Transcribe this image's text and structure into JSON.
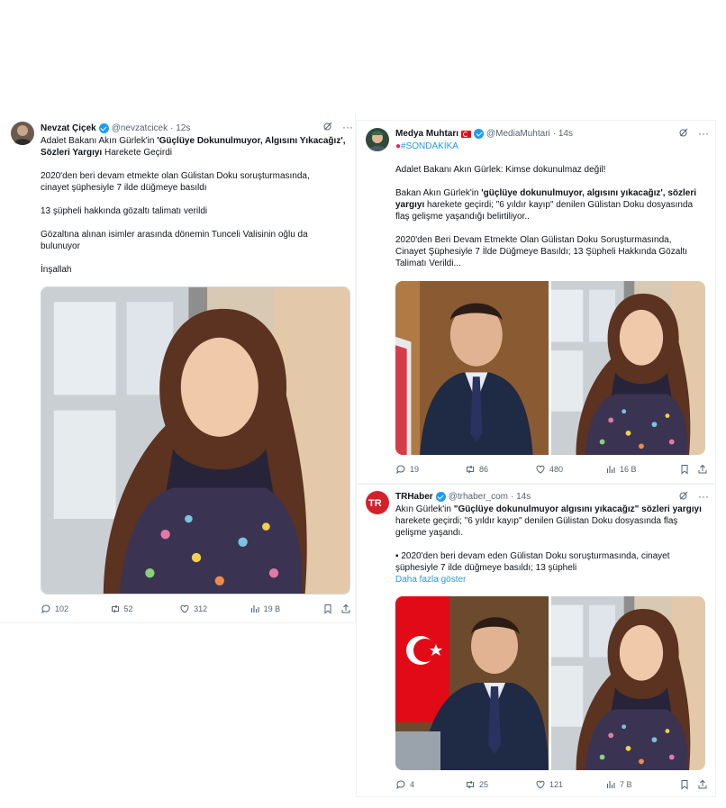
{
  "tweets": [
    {
      "name": "Nevzat Çiçek",
      "handle": "@nevzatcicek",
      "time": "· 12s",
      "lines": {
        "l1a": "Adalet Bakanı Akın Gürlek'in ",
        "l1b": "'Güçlüye Dokunulmuyor, Algısını Yıkacağız',",
        "l2a": "Sözleri Yargıyı",
        "l2b": " Harekete Geçirdi",
        "p2a": "2020'den beri devam etmekte olan Gülistan Doku soruşturmasında,",
        "p2b": "cinayet şüphesiyle 7 ilde düğmeye basıldı",
        "p3": "13 şüpheli hakkında gözaltı talimatı verildi",
        "p4a": "Gözaltına alınan isimler arasında dönemin Tunceli Valisinin oğlu da",
        "p4b": "bulunuyor",
        "p5": "İnşallah"
      },
      "stats": {
        "replies": "102",
        "reposts": "52",
        "likes": "312",
        "views": "19 B"
      }
    },
    {
      "name": "Medya Muhtarı",
      "handle": "@MediaMuhtari",
      "time": "· 14s",
      "lines": {
        "tag": "#SONDAKİKA",
        "p1": "Adalet Bakanı Akın Gürlek: Kimse dokunulmaz değil!",
        "p2a": "Bakan Akın Gürlek'in ",
        "p2b": "'güçlüye dokunulmuyor, algısını yıkacağız'",
        "p2c": ", sözleri",
        "p2d": "yargıyı",
        "p2e": " harekete geçirdi; \"6 yıldır kayıp\" denilen Gülistan Doku dosyasında",
        "p2f": "flaş gelişme yaşandığı belirtiliyor..",
        "p3a": "2020'den Beri Devam Etmekte Olan Gülistan Doku Soruşturmasında,",
        "p3b": "Cinayet Şüphesiyle 7 İlde Düğmeye Basıldı; 13 Şüpheli Hakkında Gözaltı",
        "p3c": "Talimatı Verildi..."
      },
      "stats": {
        "replies": "19",
        "reposts": "86",
        "likes": "480",
        "views": "16 B"
      }
    },
    {
      "name": "TRHaber",
      "handle": "@trhaber_com",
      "time": "· 14s",
      "lines": {
        "p1a": "Akın Gürlek'in ",
        "p1b": "\"Güçlüye dokunulmuyor algısını yıkacağız\" sözleri yargıyı",
        "p1c": "harekete geçirdi; \"6 yıldır kayıp\" denilen Gülistan Doku dosyasında flaş",
        "p1d": "gelişme yaşandı.",
        "p2a": "▪ 2020'den beri devam eden Gülistan Doku soruşturmasında, cinayet",
        "p2b": "şüphesiyle 7 ilde düğmeye basıldı; 13 şüpheli",
        "more": "Daha fazla göster"
      },
      "stats": {
        "replies": "4",
        "reposts": "25",
        "likes": "121",
        "views": "7 B"
      }
    }
  ],
  "icons": [
    "grok-icon",
    "more-icon",
    "reply-icon",
    "repost-icon",
    "like-icon",
    "views-icon",
    "bookmark-icon",
    "share-icon"
  ],
  "colors": {
    "accent": "#1d9bf0",
    "text": "#0f1419",
    "muted": "#536471",
    "hashtag": "#e0245e"
  }
}
